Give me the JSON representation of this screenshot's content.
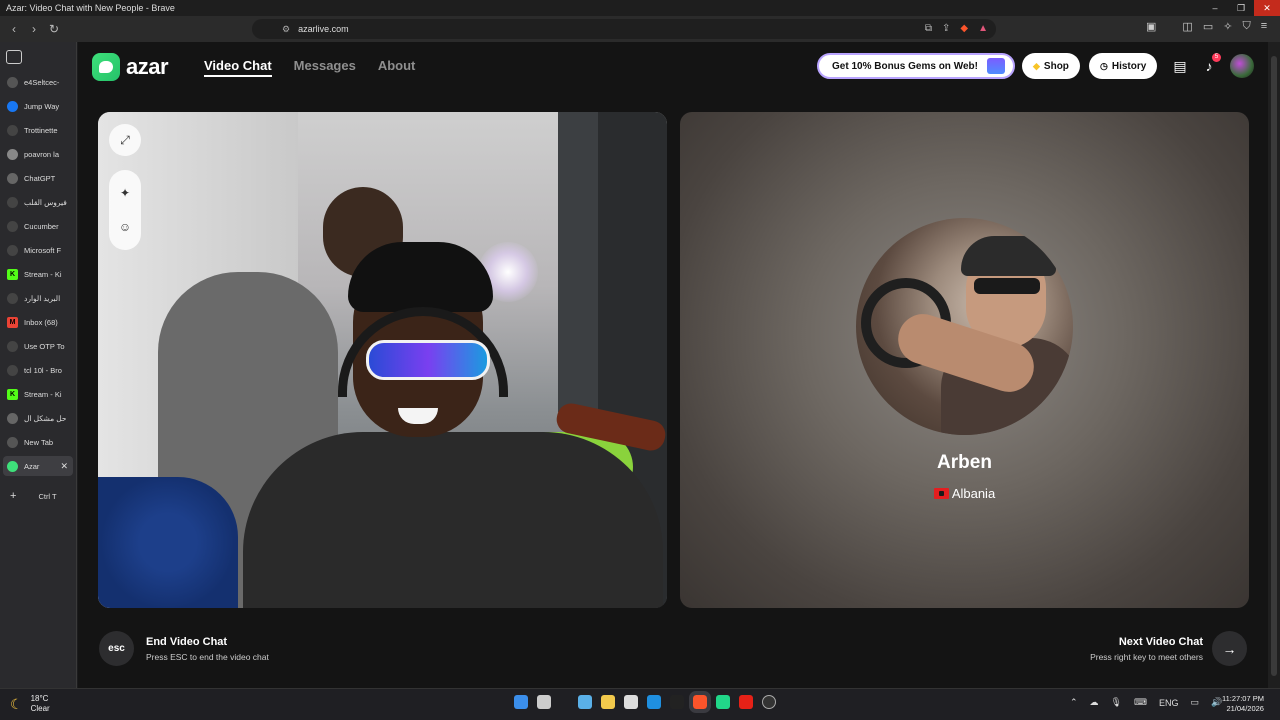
{
  "window": {
    "title": "Azar: Video Chat with New People - Brave",
    "min": "–",
    "max": "❐",
    "close": "✕"
  },
  "browser": {
    "url": "azarlive.com",
    "back": "‹",
    "forward": "›",
    "reload": "↻"
  },
  "side_tabs": [
    {
      "label": "e4Seltcec-",
      "color": "#555"
    },
    {
      "label": "Jump Way",
      "color": "#1877f2"
    },
    {
      "label": "Trottinette",
      "color": "#444"
    },
    {
      "label": "poavron la",
      "color": "#888"
    },
    {
      "label": "ChatGPT",
      "color": "#666"
    },
    {
      "label": "فيروس القلب",
      "color": "#444"
    },
    {
      "label": "Cucumber",
      "color": "#444"
    },
    {
      "label": "Microsoft F",
      "color": "#444"
    },
    {
      "label": "Stream - Ki",
      "color": "#53fc18",
      "glyph": "K"
    },
    {
      "label": "البريد الوارد",
      "color": "#444"
    },
    {
      "label": "Inbox (68)",
      "color": "#ea4335",
      "glyph": "M"
    },
    {
      "label": "Use OTP To",
      "color": "#444"
    },
    {
      "label": "tcl 10l - Bro",
      "color": "#444"
    },
    {
      "label": "Stream - Ki",
      "color": "#53fc18",
      "glyph": "K"
    },
    {
      "label": "حل مشكل ال",
      "color": "#666"
    },
    {
      "label": "New Tab",
      "color": "#555"
    },
    {
      "label": "Azar",
      "color": "#3ee07a",
      "active": true
    }
  ],
  "new_tab": {
    "plus": "+",
    "label": "Ctrl T"
  },
  "app": {
    "brand": "azar",
    "nav": {
      "video_chat": "Video Chat",
      "messages": "Messages",
      "about": "About"
    },
    "promo": "Get 10% Bonus Gems on Web!",
    "shop": "Shop",
    "history": "History",
    "notif_count": "5"
  },
  "partner": {
    "name": "Arben",
    "country": "Albania"
  },
  "footer": {
    "esc_key": "esc",
    "end_title": "End Video Chat",
    "end_sub": "Press ESC to end the video chat",
    "next_title": "Next Video Chat",
    "next_sub": "Press right key to meet others"
  },
  "taskbar": {
    "temp": "18°C",
    "weather": "Clear",
    "lang": "ENG",
    "time": "11:27:07 PM",
    "date": "21/04/2026"
  }
}
